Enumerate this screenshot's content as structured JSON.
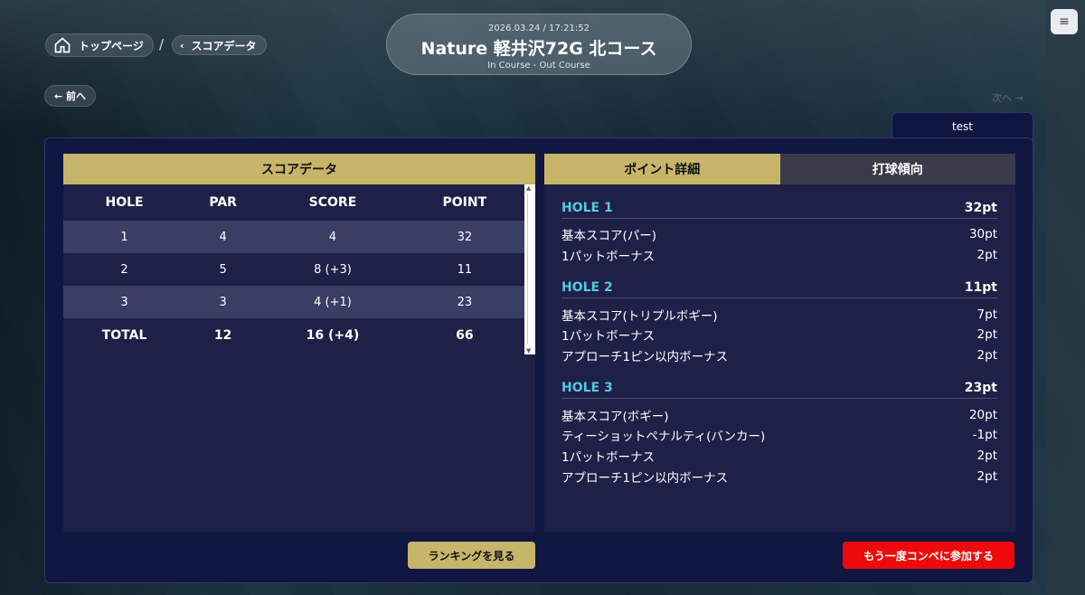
{
  "header": {
    "date": "2026.03.24 / 17:21:52",
    "course_name": "Nature 軽井沢72G 北コース",
    "course_sub": "In Course - Out Course"
  },
  "breadcrumb": {
    "home_label": "トップページ",
    "separator": "/",
    "current_label": "スコアデータ"
  },
  "nav": {
    "prev_label": "← 前へ",
    "next_label": "次へ →"
  },
  "user_tab": "test",
  "score_table": {
    "title": "スコアデータ",
    "columns": [
      "HOLE",
      "PAR",
      "SCORE",
      "POINT"
    ],
    "rows": [
      [
        "1",
        "4",
        "4",
        "32"
      ],
      [
        "2",
        "5",
        "8 (+3)",
        "11"
      ],
      [
        "3",
        "3",
        "4 (+1)",
        "23"
      ]
    ],
    "total": [
      "TOTAL",
      "12",
      "16 (+4)",
      "66"
    ]
  },
  "detail_tabs": [
    "ポイント詳細",
    "打球傾向"
  ],
  "holes": [
    {
      "label": "HOLE 1",
      "points": "32pt",
      "items": [
        {
          "name": "基本スコア(パー)",
          "pt": "30pt"
        },
        {
          "name": "1パットボーナス",
          "pt": "2pt"
        }
      ]
    },
    {
      "label": "HOLE 2",
      "points": "11pt",
      "items": [
        {
          "name": "基本スコア(トリプルボギー)",
          "pt": "7pt"
        },
        {
          "name": "1パットボーナス",
          "pt": "2pt"
        },
        {
          "name": "アプローチ1ピン以内ボーナス",
          "pt": "2pt"
        }
      ]
    },
    {
      "label": "HOLE 3",
      "points": "23pt",
      "items": [
        {
          "name": "基本スコア(ボギー)",
          "pt": "20pt"
        },
        {
          "name": "ティーショットペナルティ(バンカー)",
          "pt": "-1pt"
        },
        {
          "name": "1パットボーナス",
          "pt": "2pt"
        },
        {
          "name": "アプローチ1ピン以内ボーナス",
          "pt": "2pt"
        }
      ]
    }
  ],
  "buttons": {
    "ranking": "ランキングを見る",
    "rejoin": "もう一度コンペに参加する"
  },
  "colors": {
    "accent_gold": "#c7b56a",
    "hole_label": "#57c8e0",
    "rejoin_red": "#ee0a0a",
    "panel_bg": "#0f1741"
  }
}
